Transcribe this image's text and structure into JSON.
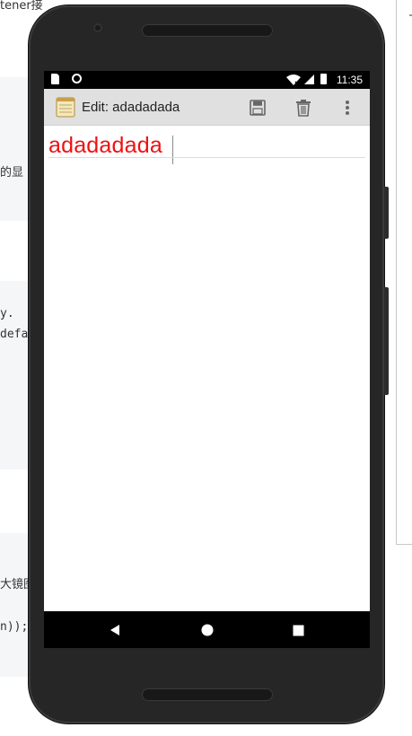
{
  "background": {
    "top_fragment": "tener接",
    "fragment_1": "的显",
    "fragment_2": "y.",
    "fragment_3": "defa",
    "fragment_4": "大镜图",
    "fragment_5": "n));"
  },
  "statusbar": {
    "time": "11:35",
    "icons": [
      "sd-card-icon",
      "circle-notification-icon",
      "wifi-icon",
      "signal-icon",
      "battery-icon"
    ]
  },
  "toolbar": {
    "title": "Edit: adadadada",
    "icons": {
      "app": "notepad-icon",
      "save": "save-icon",
      "delete": "trash-icon",
      "menu": "overflow-menu-icon"
    }
  },
  "editor": {
    "text": "adadadada",
    "text_color": "#ee1111"
  },
  "navbar": {
    "icons": [
      "back-icon",
      "home-icon",
      "recents-icon"
    ]
  }
}
